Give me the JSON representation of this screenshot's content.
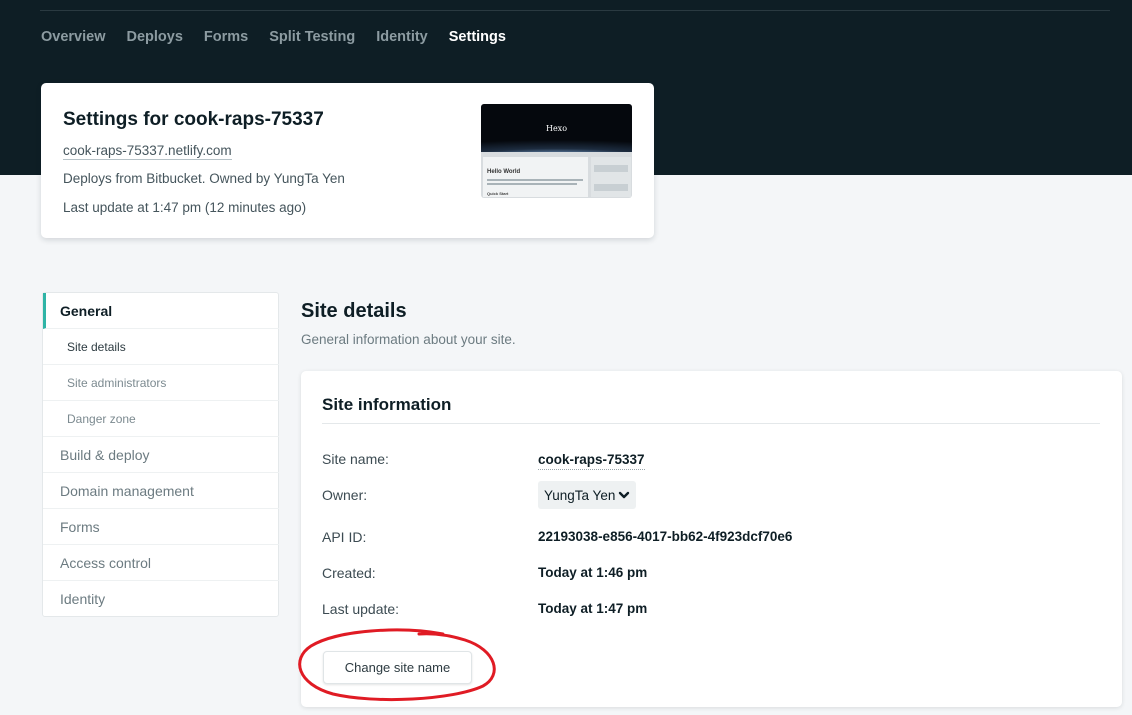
{
  "nav": {
    "items": [
      "Overview",
      "Deploys",
      "Forms",
      "Split Testing",
      "Identity",
      "Settings"
    ],
    "active": "Settings"
  },
  "site": {
    "title": "Settings for cook-raps-75337",
    "url": "cook-raps-75337.netlify.com",
    "deploys": "Deploys from Bitbucket. Owned by YungTa Yen",
    "last_update": "Last update at 1:47 pm (12 minutes ago)",
    "thumbnail": {
      "logo_text": "Hexo",
      "post_title": "Hello World",
      "section": "Quick Start"
    }
  },
  "sidebar": {
    "general": "General",
    "sub_items": [
      "Site details",
      "Site administrators",
      "Danger zone"
    ],
    "items": [
      "Build & deploy",
      "Domain management",
      "Forms",
      "Access control",
      "Identity"
    ]
  },
  "main": {
    "title": "Site details",
    "description": "General information about your site."
  },
  "site_info": {
    "title": "Site information",
    "rows": [
      {
        "label": "Site name:",
        "value": "cook-raps-75337"
      },
      {
        "label": "Owner:",
        "value": "YungTa Yen"
      },
      {
        "label": "API ID:",
        "value": "22193038-e856-4017-bb62-4f923dcf70e6"
      },
      {
        "label": "Created:",
        "value": "Today at 1:46 pm"
      },
      {
        "label": "Last update:",
        "value": "Today at 1:47 pm"
      }
    ],
    "button_label": "Change site name"
  },
  "colors": {
    "header_bg": "#0e1e25",
    "accent": "#2fb4a6",
    "annotation": "#e01b24"
  }
}
